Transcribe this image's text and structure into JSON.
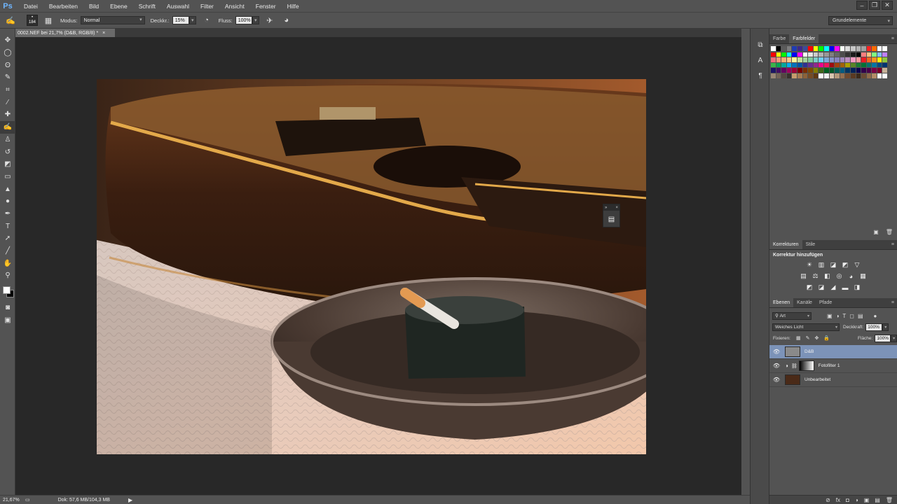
{
  "app": {
    "logo": "Ps",
    "menu": [
      "Datei",
      "Bearbeiten",
      "Bild",
      "Ebene",
      "Schrift",
      "Auswahl",
      "Filter",
      "Ansicht",
      "Fenster",
      "Hilfe"
    ],
    "window_controls": [
      "–",
      "❐",
      "✕"
    ]
  },
  "options_bar": {
    "brush_size": "184",
    "mode_label": "Modus:",
    "mode_value": "Normal",
    "opacity_label": "Deckkr.:",
    "opacity_value": "15%",
    "flow_label": "Fluss:",
    "flow_value": "100%",
    "workspace": "Grundelemente"
  },
  "document": {
    "tab_title": "0002.NEF bei 21,7% (D&B, RGB/8) *",
    "tab_close": "×"
  },
  "status": {
    "zoom": "21,67%",
    "doc_size": "Dok: 57,6 MB/104,3 MB",
    "arrow": "▶"
  },
  "toolbar": {
    "tools": [
      {
        "name": "move-tool",
        "glyph": "✥"
      },
      {
        "name": "marquee-tool",
        "glyph": "◯"
      },
      {
        "name": "lasso-tool",
        "glyph": "ʘ"
      },
      {
        "name": "quick-select-tool",
        "glyph": "✎"
      },
      {
        "name": "crop-tool",
        "glyph": "⌗"
      },
      {
        "name": "eyedropper-tool",
        "glyph": "⁄"
      },
      {
        "name": "healing-tool",
        "glyph": "✚"
      },
      {
        "name": "brush-tool",
        "glyph": "✍"
      },
      {
        "name": "clone-stamp-tool",
        "glyph": "♙"
      },
      {
        "name": "history-brush-tool",
        "glyph": "↺"
      },
      {
        "name": "eraser-tool",
        "glyph": "◩"
      },
      {
        "name": "gradient-tool",
        "glyph": "▭"
      },
      {
        "name": "blur-tool",
        "glyph": "▲"
      },
      {
        "name": "dodge-tool",
        "glyph": "●"
      },
      {
        "name": "pen-tool",
        "glyph": "✒"
      },
      {
        "name": "type-tool",
        "glyph": "T"
      },
      {
        "name": "path-select-tool",
        "glyph": "➚"
      },
      {
        "name": "line-tool",
        "glyph": "╱"
      },
      {
        "name": "hand-tool",
        "glyph": "✋"
      },
      {
        "name": "zoom-tool",
        "glyph": "⚲"
      }
    ]
  },
  "dock": {
    "icons": [
      "⧉",
      "A",
      "¶"
    ]
  },
  "swatches_panel": {
    "tabs": [
      "Farbe",
      "Farbfelder"
    ],
    "top_row": [
      "#ffffff",
      "#000000",
      "#5b5b5b",
      "#7d7d7d",
      "#1f3cb4",
      "#3d2a8a",
      "#3e4a9a",
      "#ff0000",
      "#ffff00",
      "#00ff00",
      "#00ffff",
      "#0000ff",
      "#ff00ff",
      "#ffffff",
      "#dcdcdc",
      "#c8c8c8",
      "#b4b4b4",
      "#a0a0a0",
      "#ff2020",
      "#ff6a00",
      "#ffffff",
      "#ffffff"
    ],
    "rows": [
      [
        "#ff0000",
        "#ffff00",
        "#00ff00",
        "#00ffff",
        "#0000ff",
        "#ff00ff",
        "#ffffff",
        "#e6e6e6",
        "#cccccc",
        "#b3b3b3",
        "#999999",
        "#808080",
        "#666666",
        "#4d4d4d",
        "#333333",
        "#1a1a1a",
        "#000000",
        "#ff8080",
        "#ffc080",
        "#80ff80",
        "#80c0ff",
        "#c080ff"
      ],
      [
        "#f26d7d",
        "#f7977a",
        "#fbad73",
        "#fdc68a",
        "#fff79a",
        "#c4df9b",
        "#a3d39c",
        "#82ca9d",
        "#7bcdc8",
        "#6ecff6",
        "#7ea7d8",
        "#8493ca",
        "#8882be",
        "#a187be",
        "#bc8dbf",
        "#f49ac2",
        "#f6989d",
        "#ed1c24",
        "#f26522",
        "#f7941d",
        "#fff200",
        "#8dc63f"
      ],
      [
        "#39b54a",
        "#00a651",
        "#00a99d",
        "#00aeef",
        "#0072bc",
        "#0054a6",
        "#2e3192",
        "#662d91",
        "#92278f",
        "#ec008c",
        "#ed145b",
        "#9e0b0f",
        "#a0410d",
        "#a36209",
        "#aba000",
        "#598527",
        "#1a7b30",
        "#007236",
        "#00746b",
        "#0076a3",
        "#004b80",
        "#003471"
      ],
      [
        "#1b1464",
        "#440e62",
        "#630460",
        "#9e005d",
        "#9e0039",
        "#790000",
        "#7b2e00",
        "#7d4900",
        "#827b00",
        "#406618",
        "#005e20",
        "#005826",
        "#005952",
        "#005b7f",
        "#003663",
        "#002157",
        "#0d004c",
        "#32004b",
        "#4b0049",
        "#7b0046",
        "#7a0026",
        "#c7b299"
      ],
      [
        "#998675",
        "#736357",
        "#534741",
        "#37302d",
        "#c69c6d",
        "#a67c52",
        "#8c6239",
        "#754c24",
        "#603913",
        "#ffffff",
        "#f0f0f0",
        "#d9c6b0",
        "#b59a7c",
        "#936f4f",
        "#704a2e",
        "#5a3a22",
        "#3c2a1a",
        "#6b4c34",
        "#8f6b4a",
        "#b38c66",
        "#ffffff",
        "#ffffff"
      ]
    ]
  },
  "adjustments_panel": {
    "tabs": [
      "Korrekturen",
      "Stile"
    ],
    "title": "Korrektur hinzufügen",
    "row1": [
      "☀",
      "▥",
      "◪",
      "◩",
      "▽"
    ],
    "row2": [
      "▤",
      "⚖",
      "◧",
      "◎",
      "◕",
      "▦"
    ],
    "row3": [
      "◩",
      "◪",
      "◢",
      "▬",
      "◨"
    ]
  },
  "layers_panel": {
    "tabs": [
      "Ebenen",
      "Kanäle",
      "Pfade"
    ],
    "filter_kind": "Art",
    "blend_mode": "Weiches Licht",
    "opacity_label": "Deckkraft:",
    "opacity_value": "100%",
    "lock_label": "Fixieren:",
    "fill_label": "Fläche:",
    "fill_value": "100%",
    "layers": [
      {
        "name": "D&B",
        "selected": true
      },
      {
        "name": "Fotofilter 1",
        "selected": false
      },
      {
        "name": "Unbearbeitet",
        "selected": false
      }
    ],
    "footer_icons": [
      "⊘",
      "fx",
      "◘",
      "◑",
      "▣",
      "▤",
      "🗑"
    ]
  },
  "colors": {
    "ui_bg": "#535353",
    "canvas_bg": "#282828",
    "selected_layer": "#7c93b8",
    "foreground": "#ffffff",
    "background": "#000000"
  }
}
